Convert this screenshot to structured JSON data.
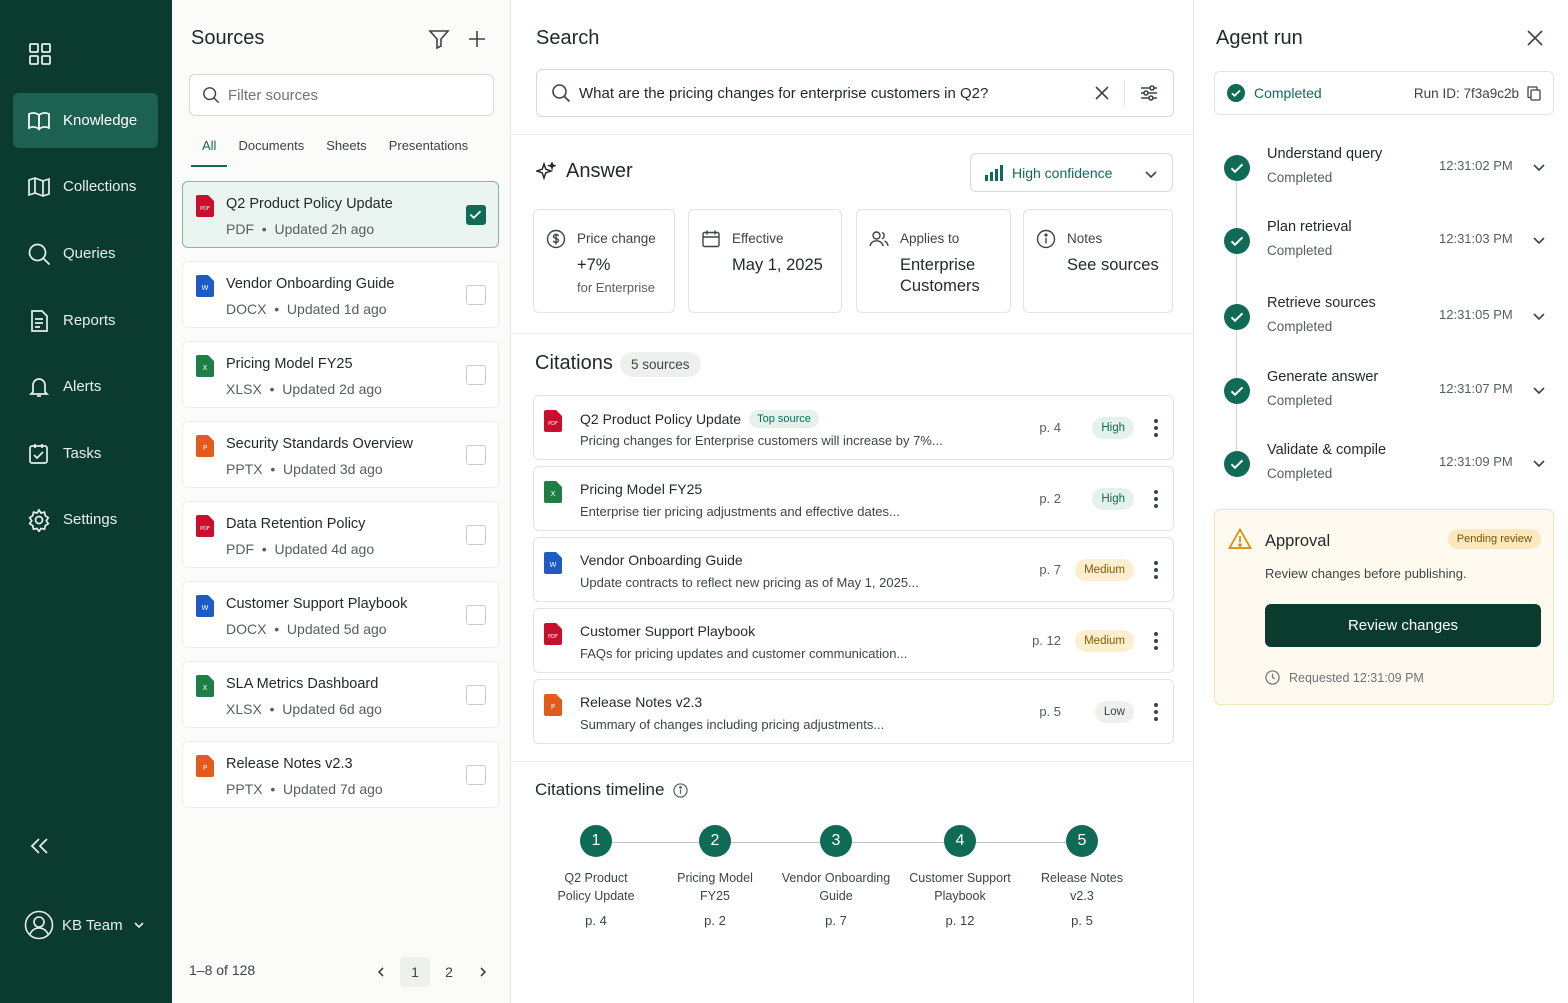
{
  "nav": {
    "logo_icon": "grid-icon",
    "items": [
      {
        "label": "Knowledge",
        "icon": "book-icon",
        "active": true
      },
      {
        "label": "Collections",
        "icon": "map-icon",
        "active": false
      },
      {
        "label": "Queries",
        "icon": "search-icon",
        "active": false
      },
      {
        "label": "Reports",
        "icon": "report-icon",
        "active": false
      },
      {
        "label": "Alerts",
        "icon": "bell-icon",
        "active": false
      },
      {
        "label": "Tasks",
        "icon": "checklist-icon",
        "active": false
      },
      {
        "label": "Settings",
        "icon": "gear-icon",
        "active": false
      }
    ],
    "team_label": "KB Team"
  },
  "sources": {
    "title": "Sources",
    "filter_placeholder": "Filter sources",
    "tabs": [
      "All",
      "Documents",
      "Sheets",
      "Presentations"
    ],
    "items": [
      {
        "name": "Q2 Product Policy Update",
        "type": "PDF",
        "updated": "Updated 2h ago",
        "selected": true
      },
      {
        "name": "Vendor Onboarding Guide",
        "type": "DOCX",
        "updated": "Updated 1d ago",
        "selected": false
      },
      {
        "name": "Pricing Model FY25",
        "type": "XLSX",
        "updated": "Updated 2d ago",
        "selected": false
      },
      {
        "name": "Security Standards Overview",
        "type": "PPTX",
        "updated": "Updated 3d ago",
        "selected": false
      },
      {
        "name": "Data Retention Policy",
        "type": "PDF",
        "updated": "Updated 4d ago",
        "selected": false
      },
      {
        "name": "Customer Support Playbook",
        "type": "DOCX",
        "updated": "Updated 5d ago",
        "selected": false
      },
      {
        "name": "SLA Metrics Dashboard",
        "type": "XLSX",
        "updated": "Updated 6d ago",
        "selected": false
      },
      {
        "name": "Release Notes v2.3",
        "type": "PPTX",
        "updated": "Updated 7d ago",
        "selected": false
      }
    ],
    "pager_text": "1–8 of 128",
    "pages": [
      "1",
      "2"
    ]
  },
  "search": {
    "title": "Search",
    "query": "What are the pricing changes for enterprise customers in Q2?"
  },
  "answer": {
    "title": "Answer",
    "confidence": "High confidence",
    "cards": [
      {
        "label": "Price change",
        "value": "+7%",
        "sub": "for Enterprise",
        "icon": "dollar-icon"
      },
      {
        "label": "Effective",
        "value": "May 1, 2025",
        "sub": "",
        "icon": "calendar-icon"
      },
      {
        "label": "Applies to",
        "value": "Enterprise Customers",
        "sub": "",
        "icon": "users-icon"
      },
      {
        "label": "Notes",
        "value": "See sources",
        "sub": "",
        "icon": "info-icon"
      }
    ]
  },
  "citations": {
    "title": "Citations",
    "count_label": "5 sources",
    "items": [
      {
        "name": "Q2 Product Policy Update",
        "tag": "Top source",
        "excerpt": "Pricing changes for Enterprise customers will increase by 7%...",
        "page": "p. 4",
        "relevance": "High",
        "type": "PDF"
      },
      {
        "name": "Pricing Model FY25",
        "tag": "",
        "excerpt": "Enterprise tier pricing adjustments and effective dates...",
        "page": "p. 2",
        "relevance": "High",
        "type": "XLSX"
      },
      {
        "name": "Vendor Onboarding Guide",
        "tag": "",
        "excerpt": "Update contracts to reflect new pricing as of May 1, 2025...",
        "page": "p. 7",
        "relevance": "Medium",
        "type": "DOCX"
      },
      {
        "name": "Customer Support Playbook",
        "tag": "",
        "excerpt": "FAQs for pricing updates and customer communication...",
        "page": "p. 12",
        "relevance": "Medium",
        "type": "PDF"
      },
      {
        "name": "Release Notes v2.3",
        "tag": "",
        "excerpt": "Summary of changes including pricing adjustments...",
        "page": "p. 5",
        "relevance": "Low",
        "type": "PPTX"
      }
    ]
  },
  "timeline": {
    "title": "Citations timeline",
    "nodes": [
      {
        "num": "1",
        "line1": "Q2 Product",
        "line2": "Policy Update",
        "page": "p. 4"
      },
      {
        "num": "2",
        "line1": "Pricing Model",
        "line2": "FY25",
        "page": "p. 2"
      },
      {
        "num": "3",
        "line1": "Vendor Onboarding",
        "line2": "Guide",
        "page": "p. 7"
      },
      {
        "num": "4",
        "line1": "Customer Support",
        "line2": "Playbook",
        "page": "p. 12"
      },
      {
        "num": "5",
        "line1": "Release Notes",
        "line2": "v2.3",
        "page": "p. 5"
      }
    ]
  },
  "agent": {
    "title": "Agent run",
    "status": "Completed",
    "run_id": "Run ID: 7f3a9c2b",
    "steps": [
      {
        "name": "Understand query",
        "status": "Completed",
        "time": "12:31:02 PM"
      },
      {
        "name": "Plan retrieval",
        "status": "Completed",
        "time": "12:31:03 PM"
      },
      {
        "name": "Retrieve sources",
        "status": "Completed",
        "time": "12:31:05 PM"
      },
      {
        "name": "Generate answer",
        "status": "Completed",
        "time": "12:31:07 PM"
      },
      {
        "name": "Validate & compile",
        "status": "Completed",
        "time": "12:31:09 PM"
      }
    ],
    "approval": {
      "title": "Approval",
      "badge": "Pending review",
      "description": "Review changes before publishing.",
      "button": "Review changes",
      "requested": "Requested 12:31:09 PM"
    }
  },
  "colors": {
    "nav_bg": "#0b3b2f",
    "accent": "#0f6b55",
    "pdf": "#c8102e",
    "docx": "#1e5bc6",
    "xlsx": "#1e7e45",
    "pptx": "#e35b1a"
  }
}
